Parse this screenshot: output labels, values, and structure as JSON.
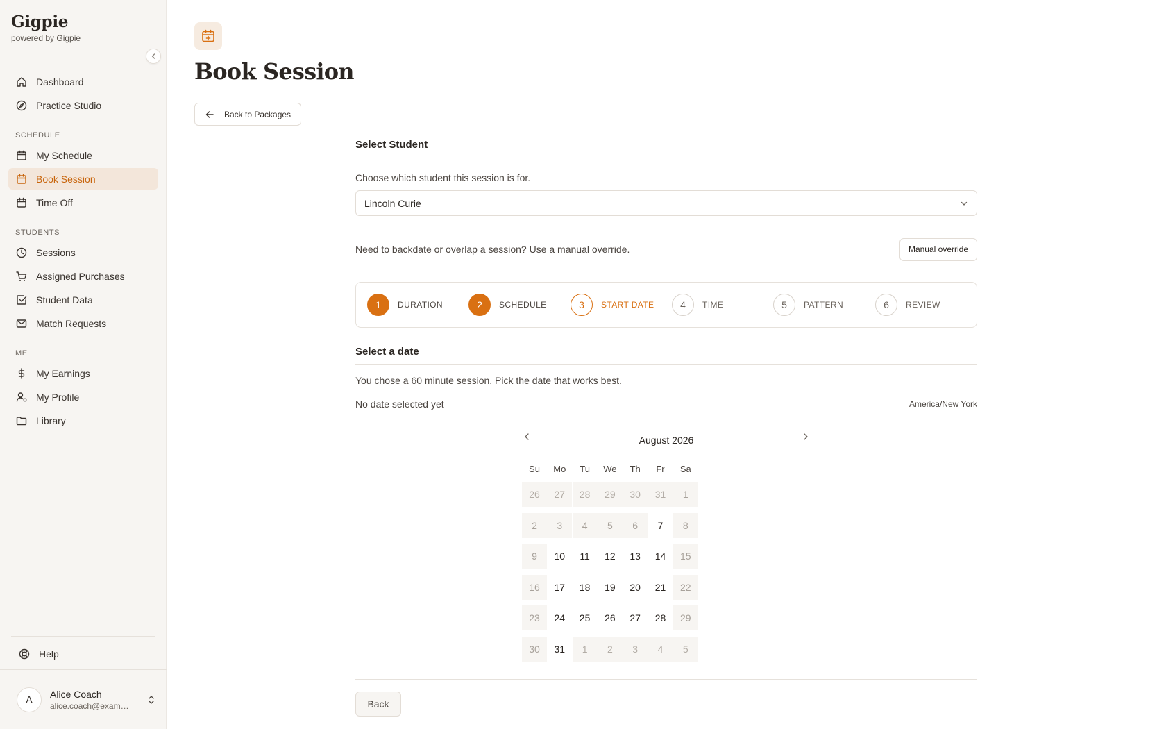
{
  "brand": {
    "title": "Gigpie",
    "subtitle": "powered by Gigpie"
  },
  "sidebar": {
    "top_items": [
      {
        "label": "Dashboard",
        "icon": "home-icon"
      },
      {
        "label": "Practice Studio",
        "icon": "compass-icon"
      }
    ],
    "sections": [
      {
        "title": "SCHEDULE",
        "items": [
          {
            "label": "My Schedule",
            "icon": "calendar-icon"
          },
          {
            "label": "Book Session",
            "icon": "calendar-plus-icon",
            "active": true
          },
          {
            "label": "Time Off",
            "icon": "calendar-icon"
          }
        ]
      },
      {
        "title": "STUDENTS",
        "items": [
          {
            "label": "Sessions",
            "icon": "clock-icon"
          },
          {
            "label": "Assigned Purchases",
            "icon": "cart-icon"
          },
          {
            "label": "Student Data",
            "icon": "checkbox-icon"
          },
          {
            "label": "Match Requests",
            "icon": "mail-icon"
          }
        ]
      },
      {
        "title": "ME",
        "items": [
          {
            "label": "My Earnings",
            "icon": "dollar-icon"
          },
          {
            "label": "My Profile",
            "icon": "user-icon"
          },
          {
            "label": "Library",
            "icon": "folder-icon"
          }
        ]
      }
    ],
    "help_label": "Help",
    "user": {
      "initial": "A",
      "name": "Alice Coach",
      "email": "alice.coach@example.com"
    }
  },
  "page": {
    "title": "Book Session",
    "back_link_label": "Back to Packages"
  },
  "student": {
    "section_title": "Select Student",
    "helper": "Choose which student this session is for.",
    "selected": "Lincoln Curie"
  },
  "override": {
    "text": "Need to backdate or overlap a session? Use a manual override.",
    "button_label": "Manual override"
  },
  "steps": [
    {
      "number": "1",
      "label": "DURATION",
      "state": "done"
    },
    {
      "number": "2",
      "label": "SCHEDULE",
      "state": "done"
    },
    {
      "number": "3",
      "label": "START DATE",
      "state": "current"
    },
    {
      "number": "4",
      "label": "TIME",
      "state": "pending"
    },
    {
      "number": "5",
      "label": "PATTERN",
      "state": "pending"
    },
    {
      "number": "6",
      "label": "REVIEW",
      "state": "pending"
    }
  ],
  "date_section": {
    "title": "Select a date",
    "description": "You chose a 60 minute session. Pick the date that works best.",
    "selected_state": "No date selected yet",
    "timezone": "America/New York"
  },
  "calendar": {
    "month_label": "August 2026",
    "weekdays": [
      "Su",
      "Mo",
      "Tu",
      "We",
      "Th",
      "Fr",
      "Sa"
    ],
    "weeks": [
      [
        {
          "d": "26",
          "s": "out"
        },
        {
          "d": "27",
          "s": "out"
        },
        {
          "d": "28",
          "s": "out"
        },
        {
          "d": "29",
          "s": "out"
        },
        {
          "d": "30",
          "s": "out"
        },
        {
          "d": "31",
          "s": "out"
        },
        {
          "d": "1",
          "s": "dis"
        }
      ],
      [
        {
          "d": "2",
          "s": "dis"
        },
        {
          "d": "3",
          "s": "dis"
        },
        {
          "d": "4",
          "s": "dis"
        },
        {
          "d": "5",
          "s": "dis"
        },
        {
          "d": "6",
          "s": "dis"
        },
        {
          "d": "7",
          "s": "ok"
        },
        {
          "d": "8",
          "s": "dis"
        }
      ],
      [
        {
          "d": "9",
          "s": "dis"
        },
        {
          "d": "10",
          "s": "ok"
        },
        {
          "d": "11",
          "s": "ok"
        },
        {
          "d": "12",
          "s": "ok"
        },
        {
          "d": "13",
          "s": "ok"
        },
        {
          "d": "14",
          "s": "ok"
        },
        {
          "d": "15",
          "s": "dis"
        }
      ],
      [
        {
          "d": "16",
          "s": "dis"
        },
        {
          "d": "17",
          "s": "ok"
        },
        {
          "d": "18",
          "s": "ok"
        },
        {
          "d": "19",
          "s": "ok"
        },
        {
          "d": "20",
          "s": "ok"
        },
        {
          "d": "21",
          "s": "ok"
        },
        {
          "d": "22",
          "s": "dis"
        }
      ],
      [
        {
          "d": "23",
          "s": "dis"
        },
        {
          "d": "24",
          "s": "ok"
        },
        {
          "d": "25",
          "s": "ok"
        },
        {
          "d": "26",
          "s": "ok"
        },
        {
          "d": "27",
          "s": "ok"
        },
        {
          "d": "28",
          "s": "ok"
        },
        {
          "d": "29",
          "s": "dis"
        }
      ],
      [
        {
          "d": "30",
          "s": "dis"
        },
        {
          "d": "31",
          "s": "ok"
        },
        {
          "d": "1",
          "s": "out"
        },
        {
          "d": "2",
          "s": "out"
        },
        {
          "d": "3",
          "s": "out"
        },
        {
          "d": "4",
          "s": "out"
        },
        {
          "d": "5",
          "s": "out"
        }
      ]
    ]
  },
  "footer": {
    "back_label": "Back"
  },
  "colors": {
    "accent": "#d97012",
    "active_bg": "#f3e6da",
    "sidebar_bg": "#f7f5f2"
  }
}
